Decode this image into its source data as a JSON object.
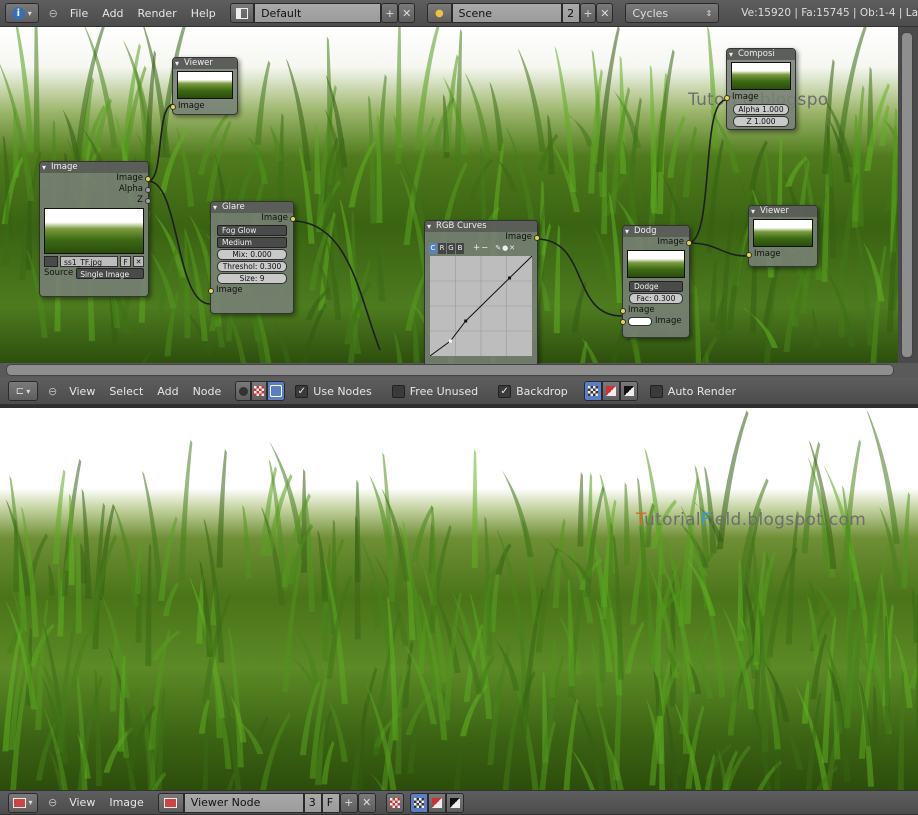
{
  "topbar": {
    "menus": [
      "File",
      "Add",
      "Render",
      "Help"
    ],
    "layout_name": "Default",
    "scene_name": "Scene",
    "scene_users": "2",
    "engine": "Cycles",
    "stats": "Ve:15920 | Fa:15745 | Ob:1-4 | La"
  },
  "watermark": {
    "top_visible": "Tutori  d.blogspo",
    "bottom_parts": [
      "T",
      "utorial",
      "F",
      "ield.blogspot.com"
    ]
  },
  "nodes": {
    "viewer1": {
      "title": "Viewer",
      "input": "Image"
    },
    "image": {
      "title": "Image",
      "outputs": [
        "Image",
        "Alpha",
        "Z"
      ],
      "file": "ss1_TF.jpg",
      "file_flag": "F",
      "source_label": "Source",
      "source": "Single Image"
    },
    "glare": {
      "title": "Glare",
      "output": "Image",
      "type": "Fog Glow",
      "quality": "Medium",
      "mix": "Mix: 0.000",
      "threshold": "Threshol: 0.300",
      "size": "Size: 9",
      "input": "Image"
    },
    "curves": {
      "title": "RGB Curves",
      "output": "Image",
      "channels": [
        "C",
        "R",
        "G",
        "B"
      ]
    },
    "dodge": {
      "title": "Dodg",
      "output": "Image",
      "mode": "Dodge",
      "fac": "Fac: 0.300",
      "inputs": [
        "Image",
        "Image"
      ]
    },
    "composite": {
      "title": "Composi",
      "inputs": [
        "Image"
      ],
      "alpha": "Alpha 1.000",
      "z": "Z 1.000"
    },
    "viewer2": {
      "title": "Viewer",
      "input": "Image"
    }
  },
  "node_header": {
    "menus": [
      "View",
      "Select",
      "Add",
      "Node"
    ],
    "use_nodes": "Use Nodes",
    "use_nodes_checked": true,
    "free_unused": "Free Unused",
    "free_unused_checked": false,
    "backdrop": "Backdrop",
    "backdrop_checked": true,
    "auto_render": "Auto Render",
    "auto_render_checked": false
  },
  "image_header": {
    "menus": [
      "View",
      "Image"
    ],
    "image_name": "Viewer Node",
    "users": "3",
    "fake_user": "F"
  },
  "curve_points": [
    [
      0,
      0
    ],
    [
      0.2,
      0.15
    ],
    [
      0.35,
      0.35
    ],
    [
      0.78,
      0.78
    ],
    [
      1,
      1
    ]
  ],
  "colors": {
    "socket_image": "#e2d84a",
    "socket_value": "#a0a0a0",
    "accent_blue": "#5b7fc4"
  }
}
